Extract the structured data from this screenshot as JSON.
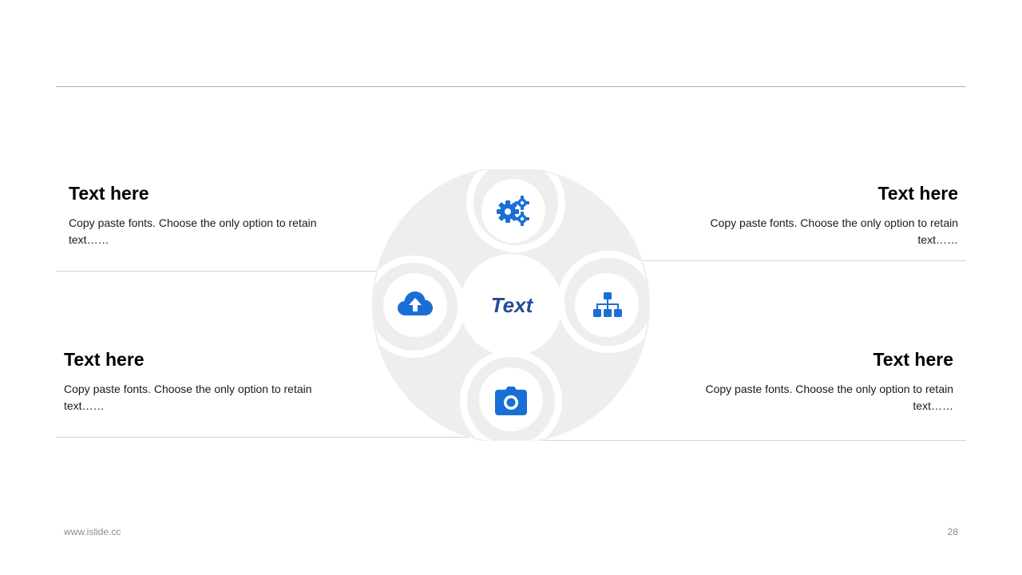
{
  "colors": {
    "accent": "#1a6fd6",
    "hub_text": "#244c99",
    "hub_bg": "#eeeeee"
  },
  "hub": {
    "center_label": "Text"
  },
  "blocks": {
    "top_left": {
      "title": "Text here",
      "body": "Copy paste fonts. Choose the only option to retain text……"
    },
    "top_right": {
      "title": "Text here",
      "body": "Copy paste fonts. Choose the only option to retain text……"
    },
    "bottom_left": {
      "title": "Text here",
      "body": "Copy paste fonts. Choose the only option to retain text……"
    },
    "bottom_right": {
      "title": "Text here",
      "body": "Copy paste fonts. Choose the only option to retain text……"
    }
  },
  "icons": [
    "gears-icon",
    "sitemap-icon",
    "camera-icon",
    "cloud-upload-icon"
  ],
  "footer": {
    "website": "www.islide.cc",
    "page_number": "28"
  }
}
